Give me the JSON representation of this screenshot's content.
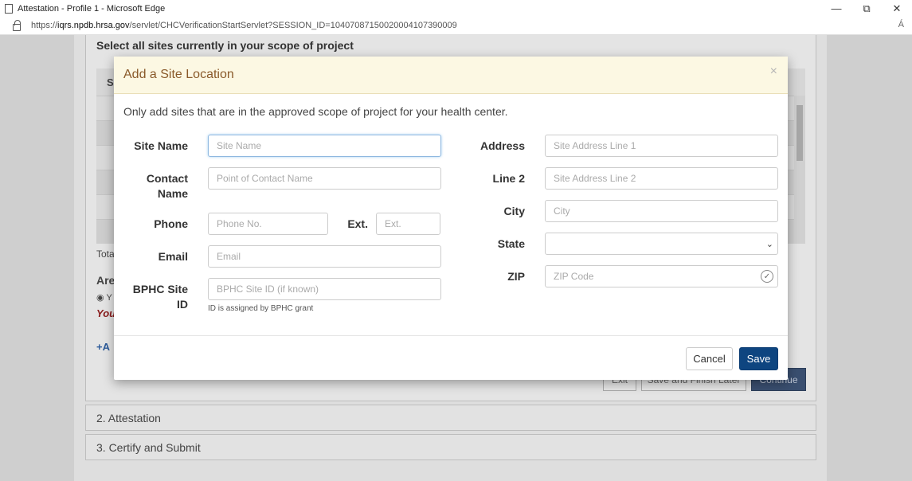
{
  "browser": {
    "window_title": "Attestation - Profile 1 - Microsoft Edge",
    "url_prefix": "https://",
    "url_domain": "iqrs.npdb.hrsa.gov",
    "url_path": "/servlet/CHCVerificationStartServlet?SESSION_ID=10407087150020004107390009",
    "minimize": "—",
    "restore": "⧉",
    "close": "✕",
    "read_aloud": "Á"
  },
  "background": {
    "section_heading": "Select all sites currently in your scope of project",
    "table_header_fragment": "S",
    "total_fragment": "Tota",
    "question_fragment": "Are",
    "radio_fragment": "◉ Y",
    "warning_fragment": "You",
    "add_fragment": "+A",
    "buttons": {
      "exit": "Exit",
      "save_finish": "Save and Finish Later",
      "continue": "Continue"
    },
    "accordion": [
      {
        "label": "2. Attestation"
      },
      {
        "label": "3. Certify and Submit"
      }
    ]
  },
  "modal": {
    "title": "Add a Site Location",
    "close": "×",
    "intro": "Only add sites that are in the approved scope of project for your health center.",
    "left": {
      "site_name": {
        "label": "Site Name",
        "placeholder": "Site Name"
      },
      "contact": {
        "label_line1": "Contact",
        "label_line2": "Name",
        "placeholder": "Point of Contact Name"
      },
      "phone": {
        "label": "Phone",
        "placeholder": "Phone No."
      },
      "ext": {
        "label": "Ext.",
        "placeholder": "Ext."
      },
      "email": {
        "label": "Email",
        "placeholder": "Email"
      },
      "bphc": {
        "label_line1": "BPHC Site",
        "label_line2": "ID",
        "placeholder": "BPHC Site ID (if known)",
        "help": "ID is assigned by BPHC grant"
      }
    },
    "right": {
      "address": {
        "label": "Address",
        "placeholder": "Site Address Line 1"
      },
      "line2": {
        "label": "Line 2",
        "placeholder": "Site Address Line 2"
      },
      "city": {
        "label": "City",
        "placeholder": "City"
      },
      "state": {
        "label": "State",
        "value": ""
      },
      "zip": {
        "label": "ZIP",
        "placeholder": "ZIP Code"
      }
    },
    "footer": {
      "cancel": "Cancel",
      "save": "Save"
    }
  },
  "colors": {
    "header_bg": "#fcf8e3",
    "title_text": "#8a5a2a",
    "save_button": "#0e4580"
  }
}
